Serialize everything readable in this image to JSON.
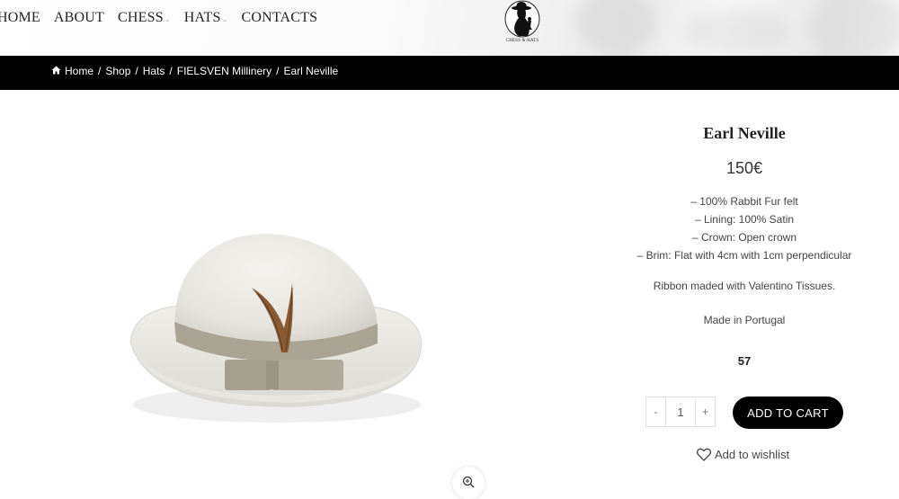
{
  "nav": {
    "items": [
      {
        "label": "HOME"
      },
      {
        "label": "ABOUT"
      },
      {
        "label": "CHESS"
      },
      {
        "label": "HATS"
      },
      {
        "label": "CONTACTS"
      }
    ]
  },
  "logo": {
    "text": "CHESS & HATS"
  },
  "breadcrumb": {
    "home": "Home",
    "shop": "Shop",
    "hats": "Hats",
    "brand": "FIELSVEN Millinery",
    "current": "Earl Neville",
    "separator": "/"
  },
  "product": {
    "title": "Earl Neville",
    "price": "150€",
    "description": [
      "– 100% Rabbit Fur felt",
      "– Lining: 100% Satin",
      "– Crown: Open crown",
      "– Brim: Flat with 4cm with 1cm perpendicular"
    ],
    "ribbon": "Ribbon maded with Valentino Tissues.",
    "made_in": "Made in Portugal",
    "size": "57",
    "quantity": {
      "minus": "-",
      "value": "1",
      "plus": "+"
    },
    "add_to_cart": "ADD TO CART",
    "wishlist": "Add to wishlist"
  },
  "icons": {
    "home": "home-icon",
    "wishlist": "heart-icon",
    "zoom": "zoom-icon",
    "caret": "chevron-down-icon"
  },
  "colors": {
    "accent": "#000000",
    "text": "#333333",
    "crumb_bar": "#000000"
  }
}
